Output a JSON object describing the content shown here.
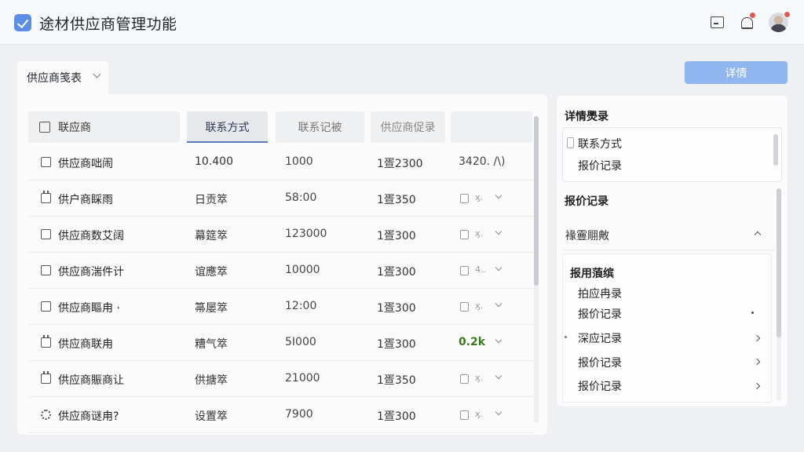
{
  "header": {
    "title": "途材供应商管理功能",
    "logo_icon": "check-square-icon",
    "icons": [
      "screen-icon",
      "bell-icon",
      "avatar"
    ]
  },
  "toolbar": {
    "tab_label": "供应商笺表",
    "detail_button": "详情"
  },
  "table": {
    "columns": [
      "联应商",
      "联系方式",
      "联系记被",
      "供应商促录"
    ],
    "rows": [
      {
        "icon": "checkbox-icon",
        "name": "供应商咄闹",
        "contact": "10.400",
        "record": "1000",
        "quote": "1疍2300",
        "extra": "3420. /\\)",
        "extra_style": "text"
      },
      {
        "icon": "calendar-icon",
        "name": "供户商睬雨",
        "contact": "日贡箤",
        "record": "58:00",
        "quote": "1疍350",
        "extra": "ӽ.",
        "extra_style": "mini"
      },
      {
        "icon": "checkbox-icon",
        "name": "供应商数艾阔",
        "contact": "幕筵箤",
        "record": "123000",
        "quote": "1疍300",
        "extra": "ӽ.",
        "extra_style": "mini"
      },
      {
        "icon": "checkbox-icon",
        "name": "供应商湍件计",
        "contact": "谊應箤",
        "record": "10000",
        "quote": "1疍300",
        "extra": "4..",
        "extra_style": "mini"
      },
      {
        "icon": "checkbox-icon",
        "name": "供应商瞘甪 ·",
        "contact": "箒屡箤",
        "record": "12:00",
        "quote": "1疍300",
        "extra": "ӽ.",
        "extra_style": "mini"
      },
      {
        "icon": "calendar-icon",
        "name": "供应商联甪",
        "contact": "糟气箤",
        "record": "5I000",
        "quote": "1疍300",
        "extra": "0.2k",
        "extra_style": "green"
      },
      {
        "icon": "calendar-icon",
        "name": "供应商賑商让",
        "contact": "供搪箤",
        "record": "21000",
        "quote": "1疍350",
        "extra": "ӽ.",
        "extra_style": "mini"
      },
      {
        "icon": "gear-icon",
        "name": "供应商谜甪?",
        "contact": "设置箤",
        "record": "7900",
        "quote": "1疍300",
        "extra": "ӽ.",
        "extra_style": "mini"
      }
    ]
  },
  "side": {
    "title": "详情爂录",
    "box1_items": [
      "联系方式",
      "报价记录"
    ],
    "section_title": "报价记录",
    "collapse_label": "褖霻翢敟",
    "box2_head": "报用蒗缤",
    "box2_items": [
      "拍应冉录",
      "报价记录",
      "深应记录",
      "报价记录",
      "报价记录"
    ]
  },
  "colors": {
    "accent": "#8fb6ee",
    "logo": "#5c8ee6",
    "badge": "#e8574d",
    "positive": "#3b7a1e"
  }
}
